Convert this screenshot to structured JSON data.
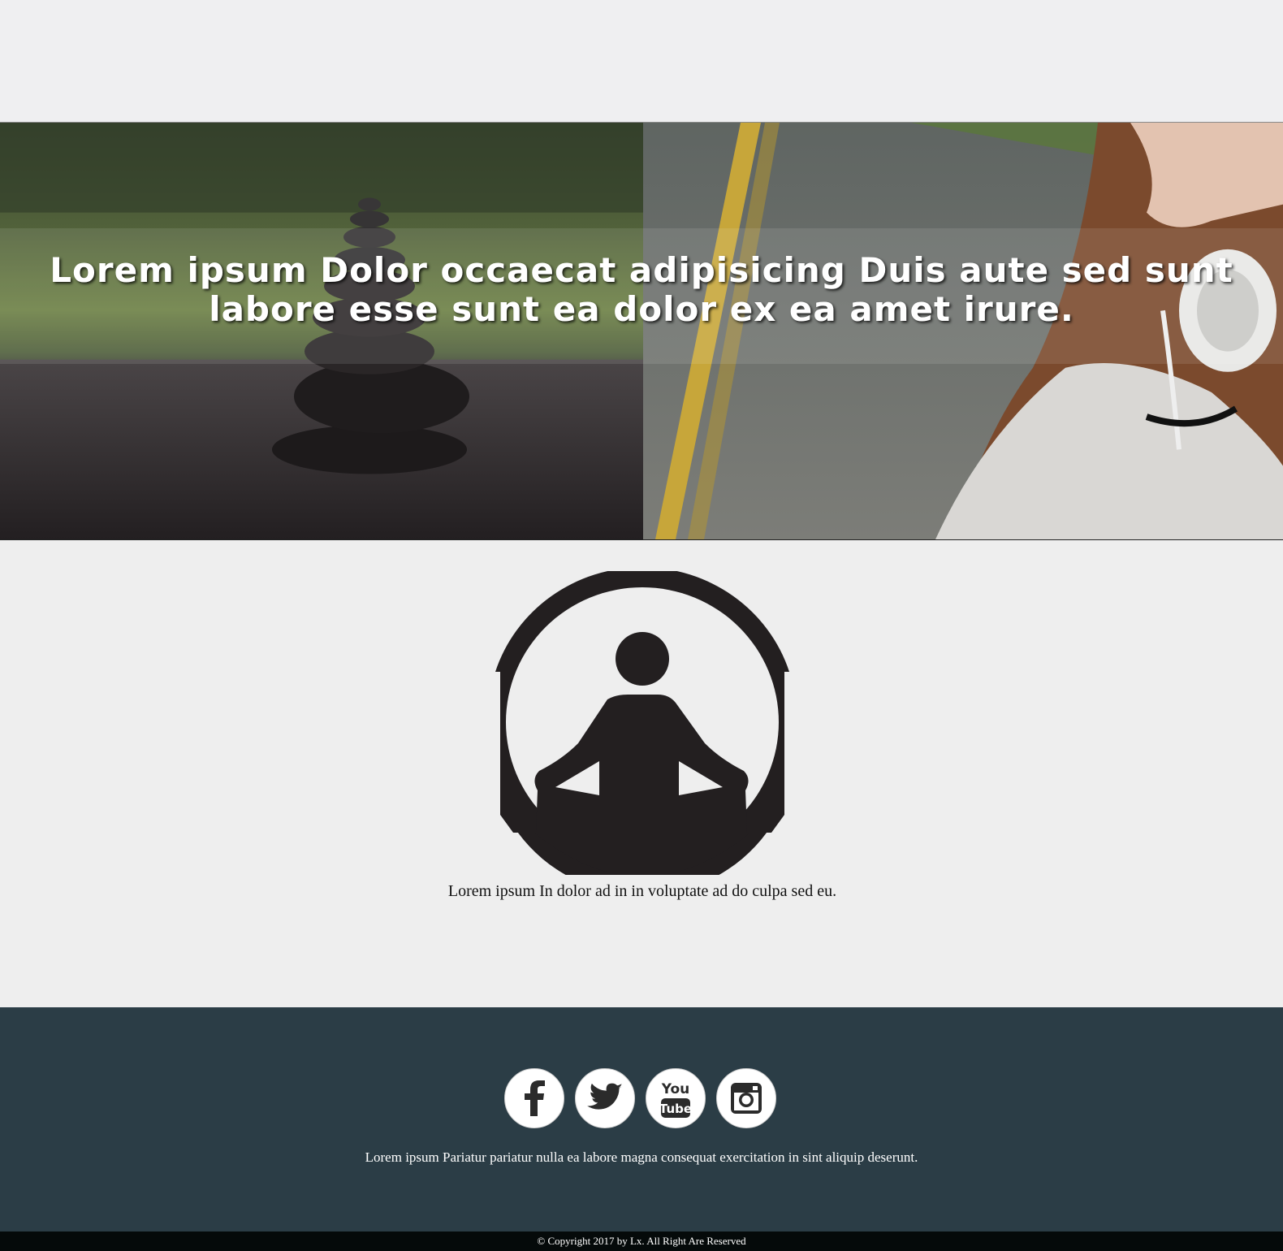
{
  "hero": {
    "title": "Lorem ipsum Dolor occaecat adipisicing Duis aute sed sunt labore esse sunt ea dolor ex ea amet irure.",
    "images": [
      "stacked-stones-in-water-photo",
      "woman-with-headphones-on-road-photo"
    ]
  },
  "middle": {
    "logo_icon": "meditation-figure-icon",
    "tagline": "Lorem ipsum In dolor ad in in voluptate ad do culpa sed eu."
  },
  "footer": {
    "socials": [
      {
        "name": "facebook-icon"
      },
      {
        "name": "twitter-icon"
      },
      {
        "name": "youtube-icon",
        "text_top": "You",
        "text_bottom": "Tube"
      },
      {
        "name": "instagram-icon"
      }
    ],
    "text": "Lorem ipsum Pariatur pariatur nulla ea labore magna consequat exercitation in sint aliquip deserunt.",
    "copyright": "© Copyright 2017 by Lx. All Right Are Reserved"
  },
  "colors": {
    "page_bg": "#efeff1",
    "footer_bg": "#2b3d46",
    "copyright_bg": "#050a0a"
  }
}
